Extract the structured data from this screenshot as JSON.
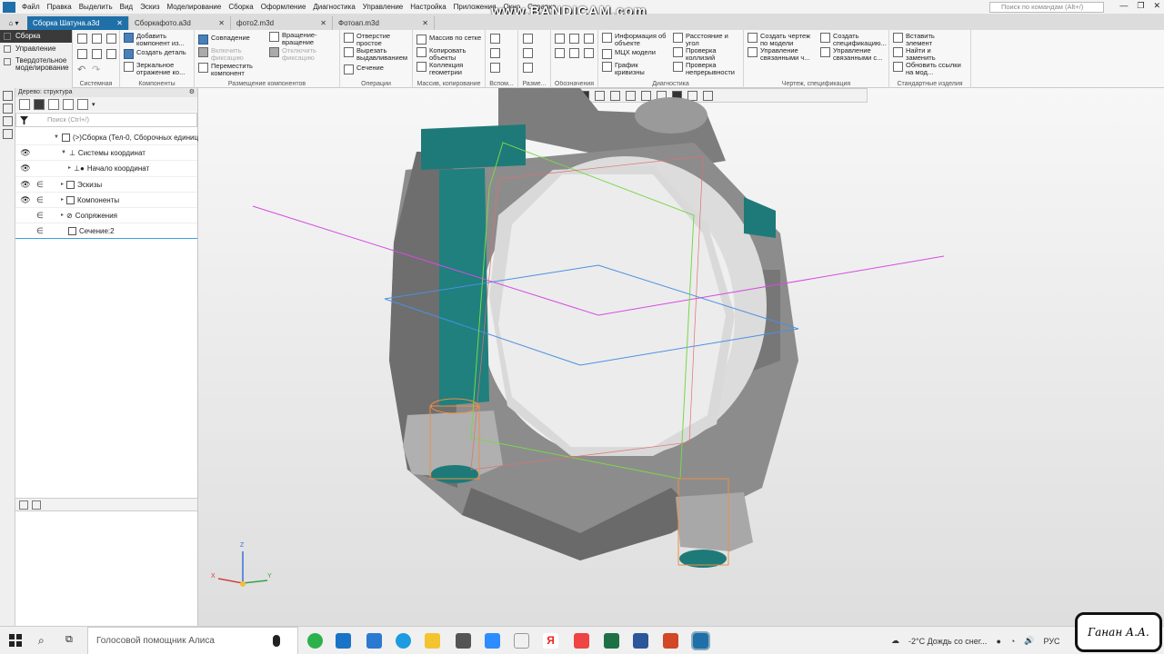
{
  "overlay": {
    "watermark": "www.BANDICAM.com"
  },
  "menubar": {
    "items": [
      "Файл",
      "Правка",
      "Выделить",
      "Вид",
      "Эскиз",
      "Моделирование",
      "Сборка",
      "Оформление",
      "Диагностика",
      "Управление",
      "Настройка",
      "Приложения",
      "Окно",
      "Справка"
    ],
    "search_placeholder": "Поиск по командам (Alt+/)"
  },
  "tabs": [
    {
      "label": "Сборка Шатуна.a3d",
      "active": true
    },
    {
      "label": "Сборкафото.a3d",
      "active": false
    },
    {
      "label": "фото2.m3d",
      "active": false
    },
    {
      "label": "Фотоап.m3d",
      "active": false
    }
  ],
  "ribbon": {
    "modes": [
      "Сборка",
      "Управление",
      "Твердотельное моделирование"
    ],
    "groups": {
      "system": "Системная",
      "components": "Компоненты",
      "placement": "Размещение компонентов",
      "operations": "Операции",
      "array": "Массив, копирование",
      "aux": "Вспом...",
      "sizes": "Разме...",
      "designations": "Обозначения",
      "diagnostics": "Диагностика",
      "drawing": "Чертеж, спецификация",
      "std": "Стандартные изделия"
    },
    "buttons": {
      "add_component": "Добавить компонент из...",
      "create_part": "Создать деталь",
      "mirror": "Зеркальное отражение ко...",
      "coincidence": "Совпадение",
      "enable_fix": "Включить фиксацию",
      "move_component": "Переместить компонент",
      "rotation": "Вращение-вращение",
      "disable_fix": "Отключить фиксацию",
      "hole": "Отверстие простое",
      "cut_extrude": "Вырезать выдавливанием",
      "section": "Сечение",
      "grid_array": "Массив по сетке",
      "copy_objects": "Копировать объекты",
      "geometry_collection": "Коллекция геометрии",
      "model_info": "Информация об объекте",
      "mcs_model": "МЦХ модели",
      "curvature": "График кривизны",
      "distance_angle": "Расстояние и угол",
      "check_collisions": "Проверка коллизий",
      "check_continuity": "Проверка непрерывности",
      "create_drawing": "Создать чертеж по модели",
      "manage_linked1": "Управление связанными ч...",
      "create_spec": "Создать спецификацию...",
      "manage_linked2": "Управление связанными с...",
      "insert_element": "Вставить элемент",
      "find_replace": "Найти и заменить",
      "update_links": "Обновить ссылки на мод..."
    }
  },
  "tree": {
    "header": "Дерево: структура",
    "filter_placeholder": "Поиск (Ctrl+/)",
    "rows": [
      {
        "label": "(>)Сборка (Тел-0, Сборочных единиц"
      },
      {
        "label": "Системы координат"
      },
      {
        "label": "Начало координат"
      },
      {
        "label": "Эскизы"
      },
      {
        "label": "Компоненты"
      },
      {
        "label": "Сопряжения"
      },
      {
        "label": "Сечение:2"
      }
    ]
  },
  "triad": {
    "x": "X",
    "y": "Y",
    "z": "Z"
  },
  "taskbar": {
    "search_text": "Голосовой помощник Алиса",
    "weather": "-2°C  Дождь со снег...",
    "lang": "РУС"
  },
  "signature": "Ганан А.А.",
  "colors": {
    "accent": "#1f6fa8",
    "bolt": "#1e7a78",
    "model": "#8a8a8a"
  }
}
